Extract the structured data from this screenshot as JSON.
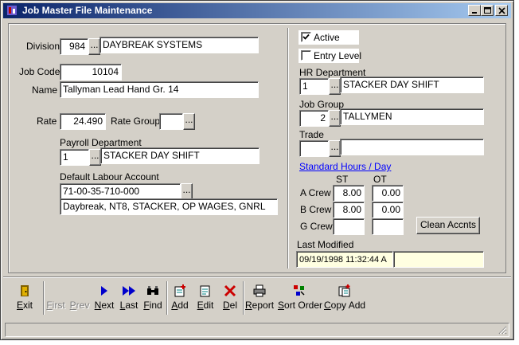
{
  "window": {
    "title": "Job Master File Maintenance"
  },
  "form": {
    "division": {
      "label": "Division",
      "code": "984",
      "name": "DAYBREAK SYSTEMS"
    },
    "job_code": {
      "label": "Job Code",
      "value": "10104"
    },
    "name": {
      "label": "Name",
      "value": "Tallyman Lead Hand Gr. 14"
    },
    "rate": {
      "label": "Rate",
      "value": "24.490"
    },
    "rate_group": {
      "label": "Rate Group",
      "value": ""
    },
    "payroll_department": {
      "label": "Payroll Department",
      "code": "1",
      "name": "STACKER DAY SHIFT"
    },
    "default_labour_account": {
      "label": "Default Labour Account",
      "value": "71-00-35-710-000",
      "description": "Daybreak, NT8, STACKER, OP WAGES, GNRL"
    },
    "active": {
      "label": "Active",
      "checked": true
    },
    "entry_level": {
      "label": "Entry Level",
      "checked": false
    },
    "hr_department": {
      "label": "HR Department",
      "code": "1",
      "name": "STACKER DAY SHIFT"
    },
    "job_group": {
      "label": "Job Group",
      "code": "2",
      "name": "TALLYMEN"
    },
    "trade": {
      "label": "Trade",
      "code": "",
      "name": ""
    },
    "standard_hours": {
      "link": "Standard Hours / Day",
      "col_st": "ST",
      "col_ot": "OT",
      "rows": [
        {
          "label": "A Crew",
          "st": "8.00",
          "ot": "0.00"
        },
        {
          "label": "B Crew",
          "st": "8.00",
          "ot": "0.00"
        },
        {
          "label": "G Crew",
          "st": "",
          "ot": ""
        }
      ]
    },
    "clear_accounts": "Clean Accnts",
    "last_modified": {
      "label": "Last Modified",
      "value": "09/19/1998 11:32:44 A",
      "user": ""
    },
    "lookup_glyph": "..."
  },
  "toolbar": {
    "exit": "Exit",
    "first": "First",
    "prev": "Prev",
    "next": "Next",
    "last": "Last",
    "find": "Find",
    "add": "Add",
    "edit": "Edit",
    "del": "Del",
    "report": "Report",
    "sort_order": "Sort Order",
    "copy_add": "Copy Add"
  },
  "colors": {
    "title_start": "#0a246a",
    "title_end": "#a6caf0",
    "face": "#d4d0c8",
    "link": "#0000ff",
    "nav_arrow": "#0000cc",
    "delete": "#cc0000"
  }
}
